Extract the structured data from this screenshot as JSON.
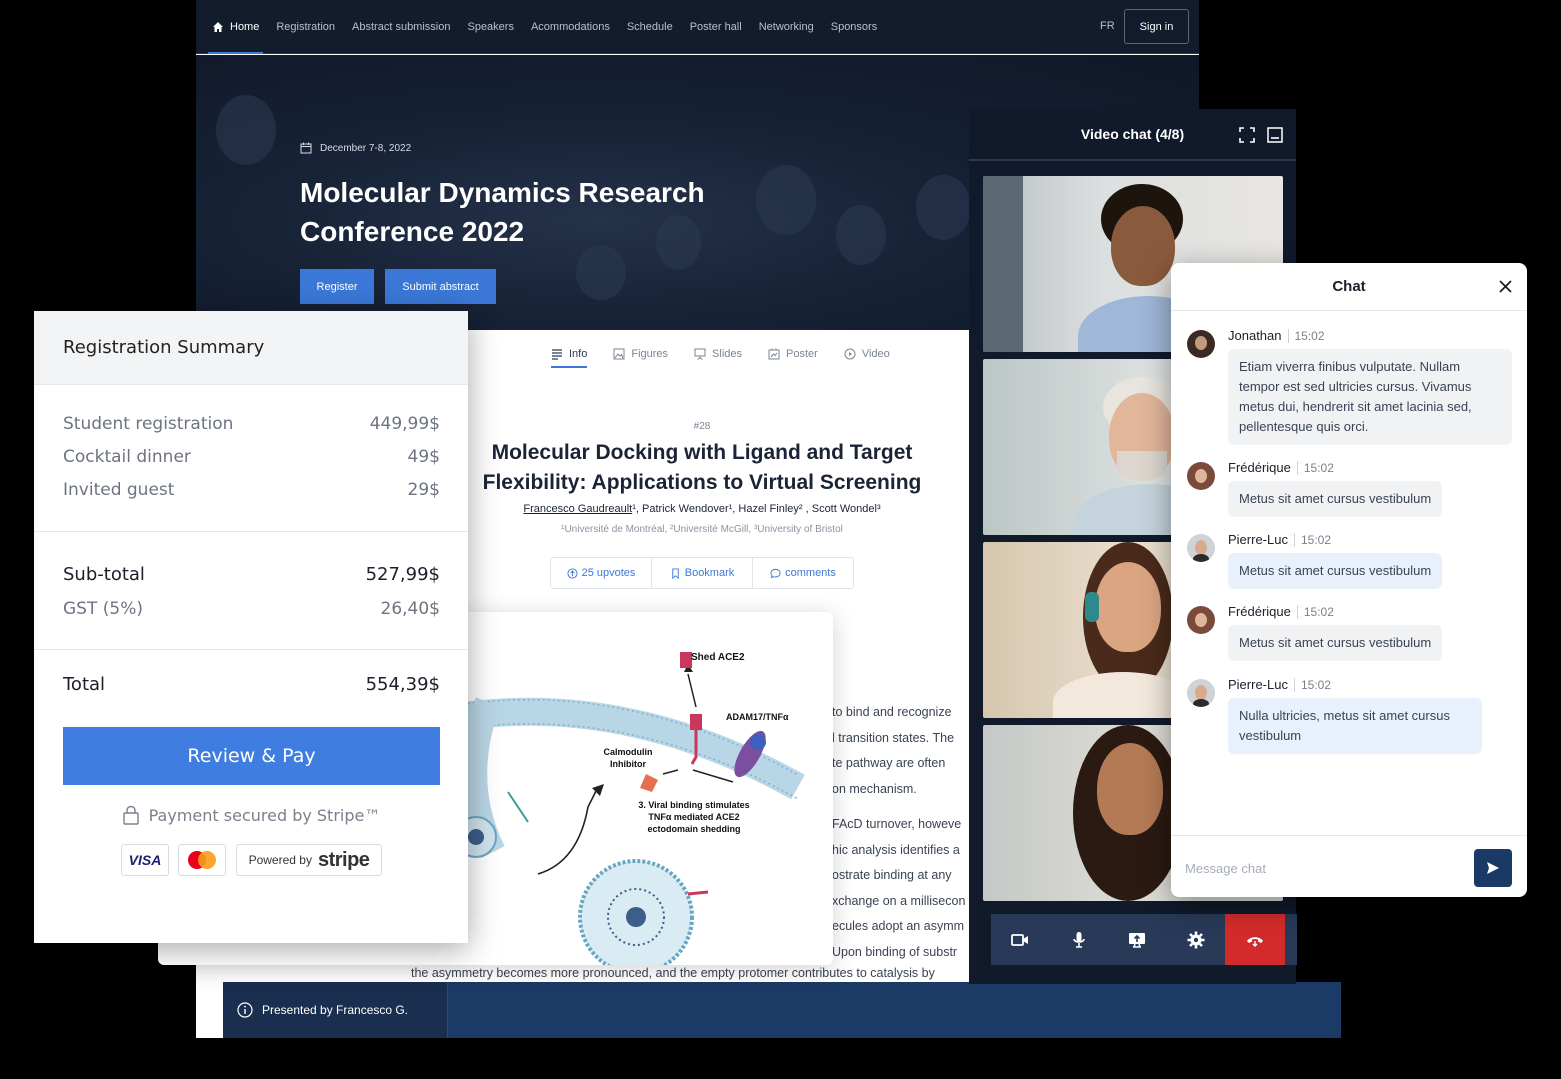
{
  "nav": {
    "items": [
      "Home",
      "Registration",
      "Abstract submission",
      "Speakers",
      "Acommodations",
      "Schedule",
      "Poster hall",
      "Networking",
      "Sponsors"
    ],
    "lang": "FR",
    "signin": "Sign in"
  },
  "hero": {
    "date": "December 7-8, 2022",
    "title": "Molecular Dynamics Research Conference 2022",
    "register": "Register",
    "submit": "Submit abstract"
  },
  "tabs": [
    "Info",
    "Figures",
    "Slides",
    "Poster",
    "Video"
  ],
  "paper": {
    "number": "#28",
    "title": "Molecular Docking with Ligand and Target Flexibility: Applications to Virtual Screening",
    "first_author": "Francesco Gaudreault",
    "other_authors": "¹, Patrick Wendover¹, Hazel Finley² , Scott Wondel³",
    "affiliations": "¹Université de Montréal, ²Université McGill, ³University of Bristol",
    "upvotes": "25 upvotes",
    "bookmark": "Bookmark",
    "comments": "comments",
    "body_lines": [
      "to bind and recognize",
      "l transition states. The",
      "te pathway are often",
      "on mechanism.",
      "FAcD turnover, howeve",
      "hic analysis identifies a",
      "ostrate binding at any",
      "xchange on a millisecon",
      "ecules adopt an asymm",
      "Upon binding of substr"
    ],
    "body_last": "the asymmetry becomes more pronounced, and the empty protomer contributes to catalysis by"
  },
  "figure": {
    "label_shed": "Shed ACE2",
    "label_adam": "ADAM17/TNFα",
    "label_calmodulin_1": "Calmodulin",
    "label_calmodulin_2": "Inhibitor",
    "label_step_1": "3. Viral binding stimulates",
    "label_step_2": "TNFα mediated ACE2",
    "label_step_3": "ectodomain shedding"
  },
  "footer": {
    "presenter": "Presented by Francesco G."
  },
  "registration": {
    "title": "Registration Summary",
    "items": [
      {
        "label": "Student registration",
        "price": "449,99$"
      },
      {
        "label": "Cocktail dinner",
        "price": "49$"
      },
      {
        "label": "Invited guest",
        "price": "29$"
      }
    ],
    "subtotal_label": "Sub-total",
    "subtotal": "527,99$",
    "gst_label": "GST (5%)",
    "gst": "26,40$",
    "total_label": "Total",
    "total": "554,39$",
    "pay_button": "Review & Pay",
    "secured": "Payment secured by Stripe™",
    "visa": "VISA",
    "powered_by": "Powered by",
    "stripe": "stripe"
  },
  "video": {
    "title": "Video chat (4/8)"
  },
  "chat": {
    "title": "Chat",
    "placeholder": "Message chat",
    "messages": [
      {
        "name": "Jonathan",
        "time": "15:02",
        "text": "Etiam viverra finibus vulputate. Nullam tempor est sed ultricies cursus. Vivamus metus dui, hendrerit sit amet lacinia sed, pellentesque quis orci."
      },
      {
        "name": "Frédérique",
        "time": "15:02",
        "text": "Metus sit amet cursus vestibulum"
      },
      {
        "name": "Pierre-Luc",
        "time": "15:02",
        "text": "Metus sit amet cursus vestibulum"
      },
      {
        "name": "Frédérique",
        "time": "15:02",
        "text": "Metus sit amet cursus vestibulum"
      },
      {
        "name": "Pierre-Luc",
        "time": "15:02",
        "text": "Nulla ultricies, metus sit amet cursus vestibulum"
      }
    ]
  },
  "colors": {
    "accent": "#3b78d8",
    "nav_bg": "#131c2c",
    "end_call": "#d32b2b"
  }
}
